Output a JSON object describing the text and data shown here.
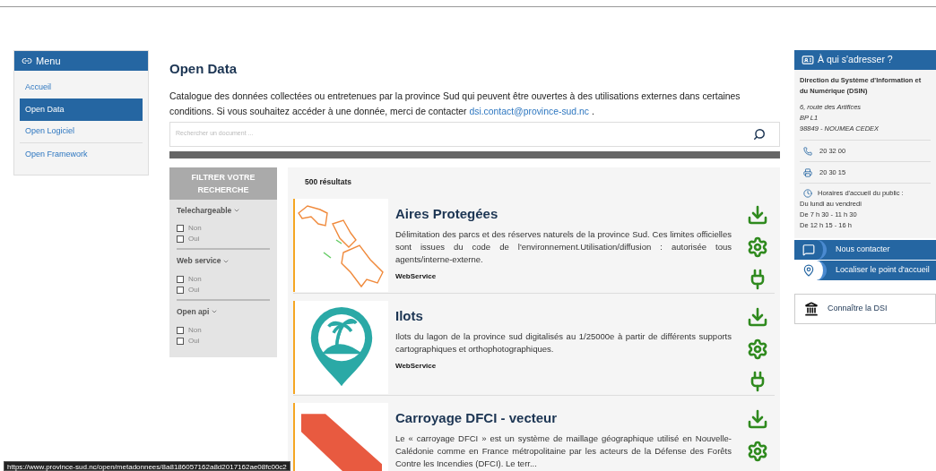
{
  "menu": {
    "title": "Menu",
    "items": [
      {
        "label": "Accueil",
        "selected": false
      },
      {
        "label": "Open Data",
        "selected": true
      },
      {
        "label": "Open Logiciel",
        "selected": false
      },
      {
        "label": "Open Framework",
        "selected": false
      }
    ]
  },
  "page": {
    "title": "Open Data",
    "intro": "Catalogue des données collectées ou entretenues par la province Sud qui peuvent être ouvertes à des utilisations externes dans certaines conditions. Si vous souhaitez accéder à une donnée, merci de contacter",
    "email": "dsi.contact@province-sud.nc",
    "intro_end": ".",
    "search": {
      "placeholder": "Rechercher un document ..."
    }
  },
  "filters": {
    "title": "FILTRER VOTRE RECHERCHE",
    "groups": [
      {
        "label": "Telechargeable",
        "options": [
          {
            "label": "Non",
            "checked": false
          },
          {
            "label": "Oui",
            "checked": false
          }
        ]
      },
      {
        "label": "Web service",
        "options": [
          {
            "label": "Non",
            "checked": false
          },
          {
            "label": "Oui",
            "checked": false
          }
        ]
      },
      {
        "label": "Open api",
        "options": [
          {
            "label": "Non",
            "checked": false
          },
          {
            "label": "Oui",
            "checked": false
          }
        ]
      }
    ]
  },
  "results": {
    "count": "500 résultats",
    "items": [
      {
        "kind": "outline-map",
        "title": "Aires Protegées",
        "description": "Délimitation des parcs et des réserves naturels de la province Sud. Ces limites officielles sont issues du code de l'environnement.Utilisation/diffusion : autorisée tous agents/interne-externe.",
        "tag": "WebService",
        "actions": [
          {
            "kind": "download"
          },
          {
            "kind": "settings"
          },
          {
            "kind": "plug"
          }
        ]
      },
      {
        "kind": "island-pin",
        "title": "Ilots",
        "description": "Ilots du lagon de la province sud digitalisés au 1/25000e à partir de différents supports cartographiques et orthophotographiques.",
        "tag": "WebService",
        "actions": [
          {
            "kind": "download"
          },
          {
            "kind": "settings"
          },
          {
            "kind": "plug"
          }
        ]
      },
      {
        "kind": "grid-map",
        "title": "Carroyage DFCI - vecteur",
        "description": "Le « carroyage DFCI » est un système de maillage géographique utilisé en Nouvelle-Calédonie comme en France métropolitaine par les acteurs de la Défense des Forêts Contre les Incendies (DFCI). Le terr...",
        "actions": [
          {
            "kind": "download"
          },
          {
            "kind": "settings"
          }
        ]
      }
    ]
  },
  "contact": {
    "title": "À qui s'adresser ?",
    "org": "Direction du Système d'Information et du Numérique (DSIN)",
    "address": [
      "6, route des Artifices",
      "BP L1",
      "98849 - NOUMEA CEDEX"
    ],
    "phone": "20 32 00",
    "fax": "20 30 15",
    "hours_title": "Horaires d'accueil du public :",
    "hours": [
      "Du lundi au vendredi",
      "De 7 h 30 - 11 h 30",
      "De 12 h 15 - 16 h"
    ],
    "links": [
      {
        "kind": "message",
        "label": "Nous contacter"
      },
      {
        "kind": "location",
        "label": "Localiser le point d'accueil"
      }
    ],
    "about": "Connaître la DSI"
  },
  "status_url": "https://www.province-sud.nc/open/metadonnees/8a8186057162a8d2017162ae08fc00c2"
}
